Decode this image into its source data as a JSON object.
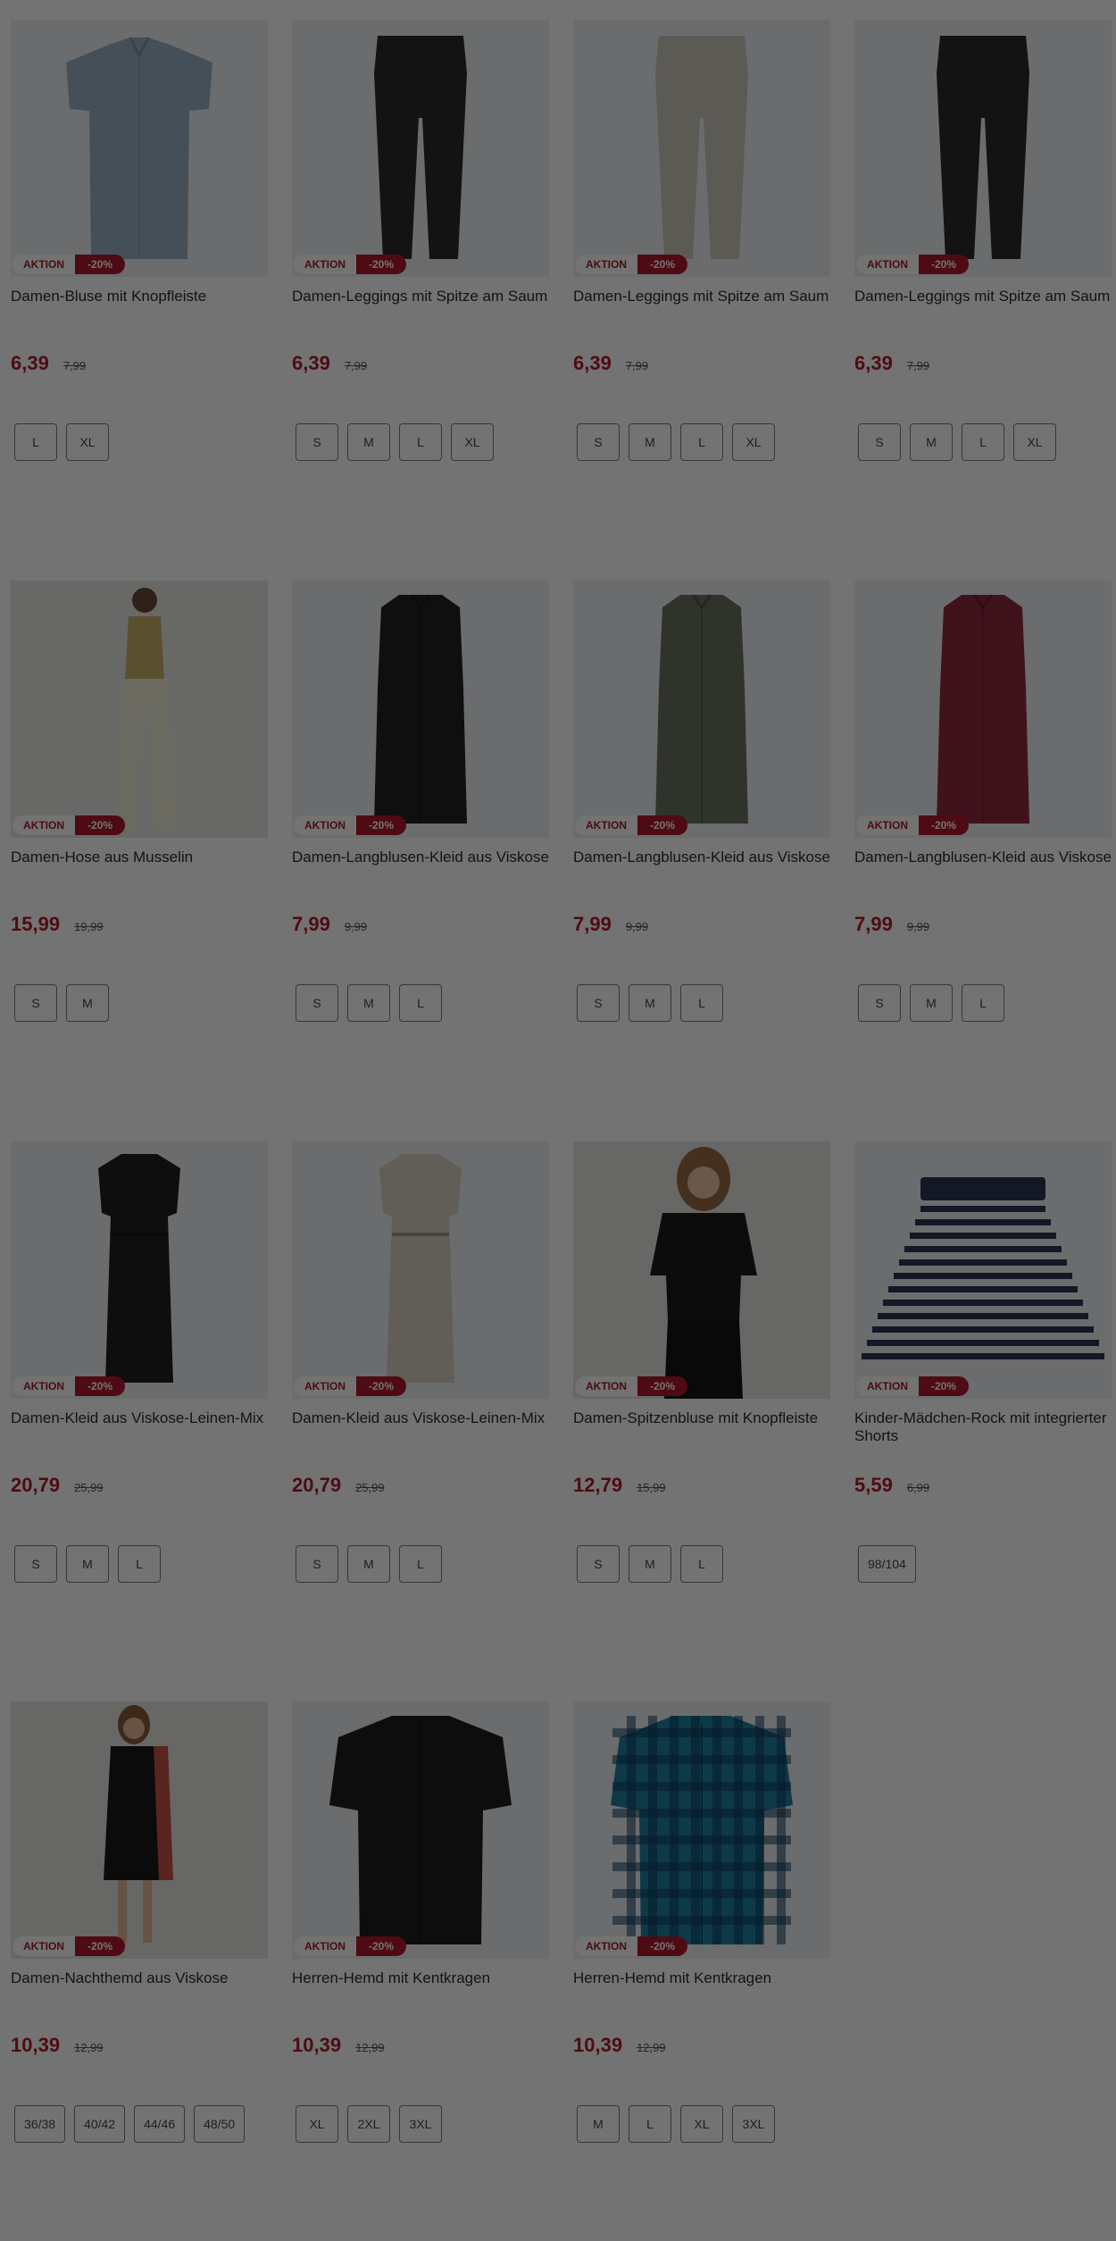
{
  "products": [
    {
      "name": "Damen-Bluse mit Knopfleiste",
      "price": "6,39",
      "old_price": "7,99",
      "badge": "AKTION",
      "discount": "-20%",
      "sizes": [
        "L",
        "XL"
      ],
      "image": "blouse-grey-icon",
      "color": "#9ab0c0"
    },
    {
      "name": "Damen-Leggings mit Spitze am Saum",
      "price": "6,39",
      "old_price": "7,99",
      "badge": "AKTION",
      "discount": "-20%",
      "sizes": [
        "S",
        "M",
        "L",
        "XL"
      ],
      "image": "leggings-black-icon",
      "color": "#2a2c2e"
    },
    {
      "name": "Damen-Leggings mit Spitze am Saum",
      "price": "6,39",
      "old_price": "7,99",
      "badge": "AKTION",
      "discount": "-20%",
      "sizes": [
        "S",
        "M",
        "L",
        "XL"
      ],
      "image": "leggings-beige-icon",
      "color": "#c9c7bd"
    },
    {
      "name": "Damen-Leggings mit Spitze am Saum",
      "price": "6,39",
      "old_price": "7,99",
      "badge": "AKTION",
      "discount": "-20%",
      "sizes": [
        "S",
        "M",
        "L",
        "XL"
      ],
      "image": "leggings-black-icon",
      "color": "#2a2a2a"
    },
    {
      "name": "Damen-Hose aus Musselin",
      "price": "15,99",
      "old_price": "19,99",
      "badge": "AKTION",
      "discount": "-20%",
      "sizes": [
        "S",
        "M"
      ],
      "image": "model-pants-icon",
      "color": "#ecebd8"
    },
    {
      "name": "Damen-Langblusen-Kleid aus Viskose",
      "price": "7,99",
      "old_price": "9,99",
      "badge": "AKTION",
      "discount": "-20%",
      "sizes": [
        "S",
        "M",
        "L"
      ],
      "image": "dress-black-icon",
      "color": "#222222"
    },
    {
      "name": "Damen-Langblusen-Kleid aus Viskose",
      "price": "7,99",
      "old_price": "9,99",
      "badge": "AKTION",
      "discount": "-20%",
      "sizes": [
        "S",
        "M",
        "L"
      ],
      "image": "dress-olive-icon",
      "color": "#6b7260"
    },
    {
      "name": "Damen-Langblusen-Kleid aus Viskose",
      "price": "7,99",
      "old_price": "9,99",
      "badge": "AKTION",
      "discount": "-20%",
      "sizes": [
        "S",
        "M",
        "L"
      ],
      "image": "dress-red-icon",
      "color": "#8e2a3e"
    },
    {
      "name": "Damen-Kleid aus Viskose-Leinen-Mix",
      "price": "20,79",
      "old_price": "25,99",
      "badge": "AKTION",
      "discount": "-20%",
      "sizes": [
        "S",
        "M",
        "L"
      ],
      "image": "long-dress-black-icon",
      "color": "#1f1f1f"
    },
    {
      "name": "Damen-Kleid aus Viskose-Leinen-Mix",
      "price": "20,79",
      "old_price": "25,99",
      "badge": "AKTION",
      "discount": "-20%",
      "sizes": [
        "S",
        "M",
        "L"
      ],
      "image": "long-dress-beige-icon",
      "color": "#d6d0bf"
    },
    {
      "name": "Damen-Spitzenbluse mit Knopfleiste",
      "price": "12,79",
      "old_price": "15,99",
      "badge": "AKTION",
      "discount": "-20%",
      "sizes": [
        "S",
        "M",
        "L"
      ],
      "image": "model-lace-blouse-icon",
      "color": "#1c1c1c"
    },
    {
      "name": "Kinder-Mädchen-Rock mit integrierter Shorts",
      "price": "5,59",
      "old_price": "6,99",
      "badge": "AKTION",
      "discount": "-20%",
      "sizes": [
        "98/104"
      ],
      "image": "striped-skirt-icon",
      "color": "#2b3550"
    },
    {
      "name": "Damen-Nachthemd aus Viskose",
      "price": "10,39",
      "old_price": "12,99",
      "badge": "AKTION",
      "discount": "-20%",
      "sizes": [
        "36/38",
        "40/42",
        "44/46",
        "48/50"
      ],
      "image": "model-nightgown-icon",
      "color": "#1a1a1a"
    },
    {
      "name": "Herren-Hemd mit Kentkragen",
      "price": "10,39",
      "old_price": "12,99",
      "badge": "AKTION",
      "discount": "-20%",
      "sizes": [
        "XL",
        "2XL",
        "3XL"
      ],
      "image": "shirt-black-icon",
      "color": "#1e1e1e"
    },
    {
      "name": "Herren-Hemd mit Kentkragen",
      "price": "10,39",
      "old_price": "12,99",
      "badge": "AKTION",
      "discount": "-20%",
      "sizes": [
        "M",
        "L",
        "XL",
        "3XL"
      ],
      "image": "shirt-plaid-icon",
      "color": "#1f7fa3"
    }
  ]
}
